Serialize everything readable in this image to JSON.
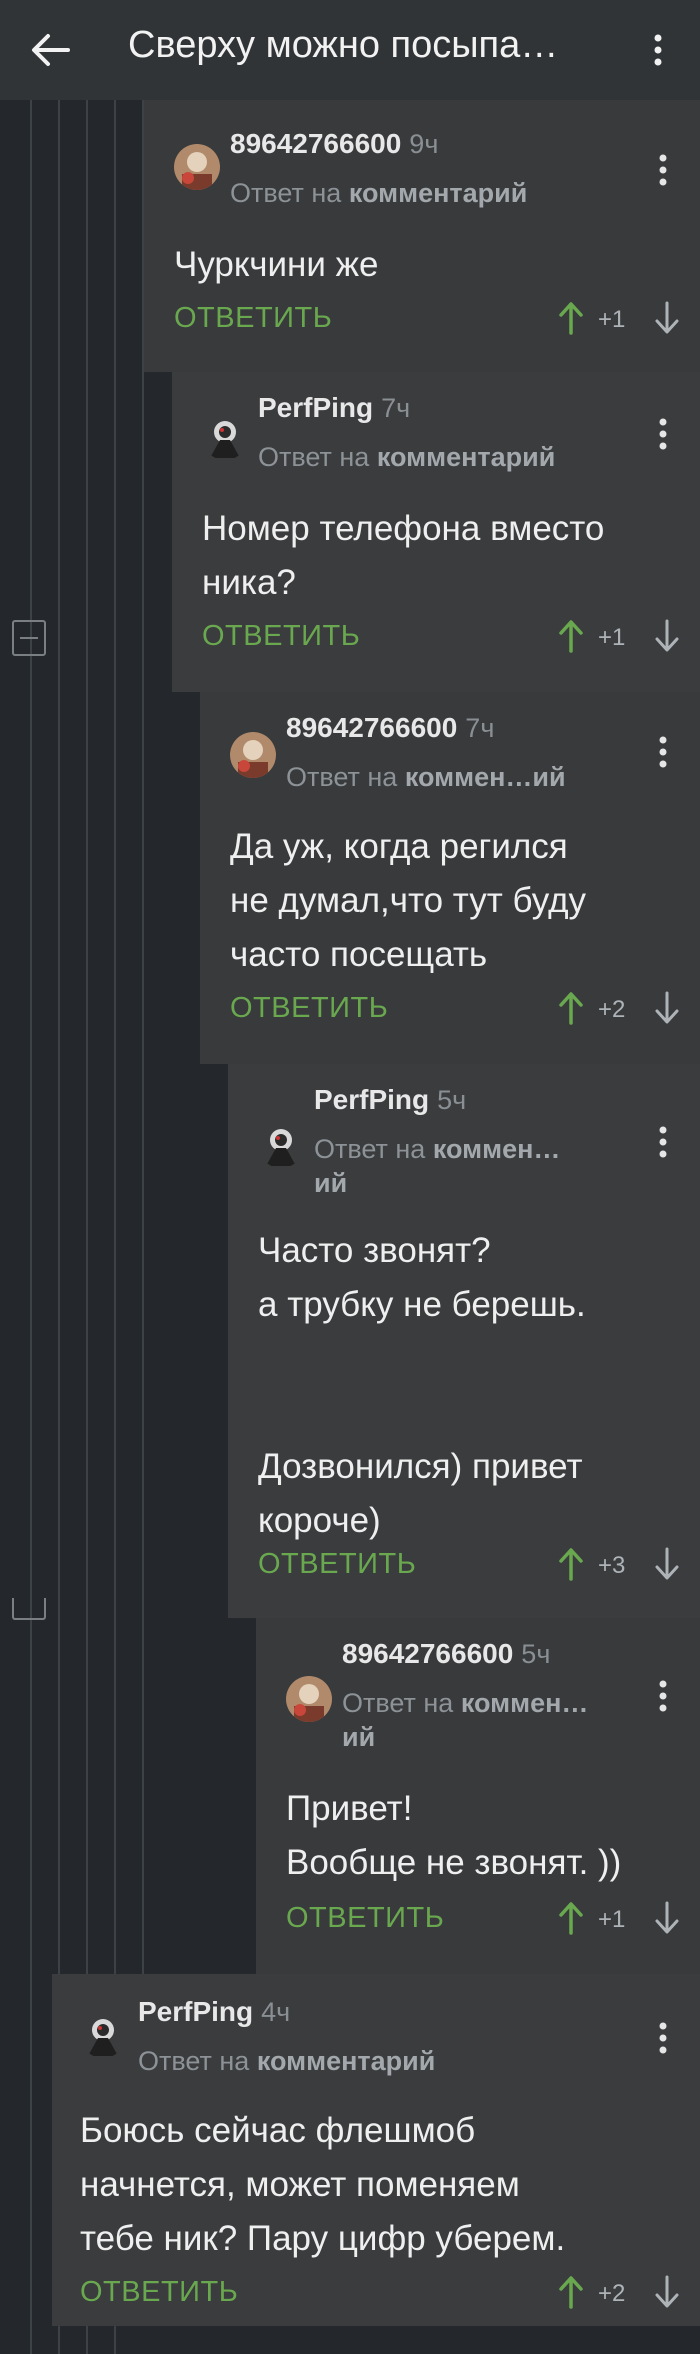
{
  "appbar": {
    "title": "Сверху можно посыпа…",
    "back_icon": "arrow-left-icon",
    "menu_icon": "more-vertical-icon"
  },
  "labels": {
    "reply_prefix": "Ответ на"
  },
  "comments": [
    {
      "author": "89642766600",
      "time": "9ч",
      "reply_target": "комментарий",
      "text": "Чуркчини же",
      "answer": "ОТВЕТИТЬ",
      "score": "+1"
    },
    {
      "author": "PerfPing",
      "time": "7ч",
      "reply_target": "комментарий",
      "text": "Номер телефона вместо\nника?",
      "answer": "ОТВЕТИТЬ",
      "score": "+1"
    },
    {
      "author": "89642766600",
      "time": "7ч",
      "reply_target": "коммен…ий",
      "text": "Да уж, когда регился\nне думал,что тут буду\nчасто посещать",
      "answer": "ОТВЕТИТЬ",
      "score": "+2"
    },
    {
      "author": "PerfPing",
      "time": "5ч",
      "reply_target": "коммен…\nий",
      "text": "Часто звонят?\nа трубку не берешь.\n\n\nДозвонился) привет\nкороче)",
      "answer": "ОТВЕТИТЬ",
      "score": "+3"
    },
    {
      "author": "89642766600",
      "time": "5ч",
      "reply_target": "коммен…\nий",
      "text": "Привет!\nВообще не звонят. ))",
      "answer": "ОТВЕТИТЬ",
      "score": "+1"
    },
    {
      "author": "PerfPing",
      "time": "4ч",
      "reply_target": "комментарий",
      "text": "Боюсь сейчас флешмоб\nначнется, может поменяем\nтебе ник? Пару цифр уберем.",
      "answer": "ОТВЕТИТЬ",
      "score": "+2"
    }
  ],
  "colors": {
    "background": "#24282d",
    "comment_bg": "#3a3c3e",
    "accent_green": "#6aa84f"
  }
}
